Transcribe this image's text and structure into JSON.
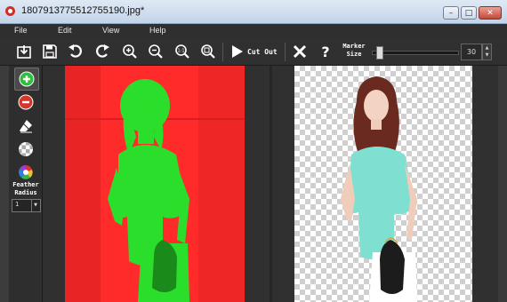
{
  "window": {
    "title": "1807913775512755190.jpg*",
    "controls": {
      "minimize": "–",
      "maximize": "□",
      "close": "✕"
    }
  },
  "menu": [
    "File",
    "Edit",
    "View",
    "Help"
  ],
  "toolbar": {
    "cut_out_label": "Cut Out",
    "marker_size_label_line1": "Marker",
    "marker_size_label_line2": "Size",
    "marker_size_value": "30",
    "marker_size_level": 0.05
  },
  "left_tools": {
    "feather_radius_line1": "Feather",
    "feather_radius_line2": "Radius",
    "feather_radius_value": "1"
  },
  "colors": {
    "background_mask": "#ff2727",
    "foreground_mask": "#2bde2b",
    "add_tool": "#2fbf3a",
    "remove_tool": "#d9362b"
  }
}
